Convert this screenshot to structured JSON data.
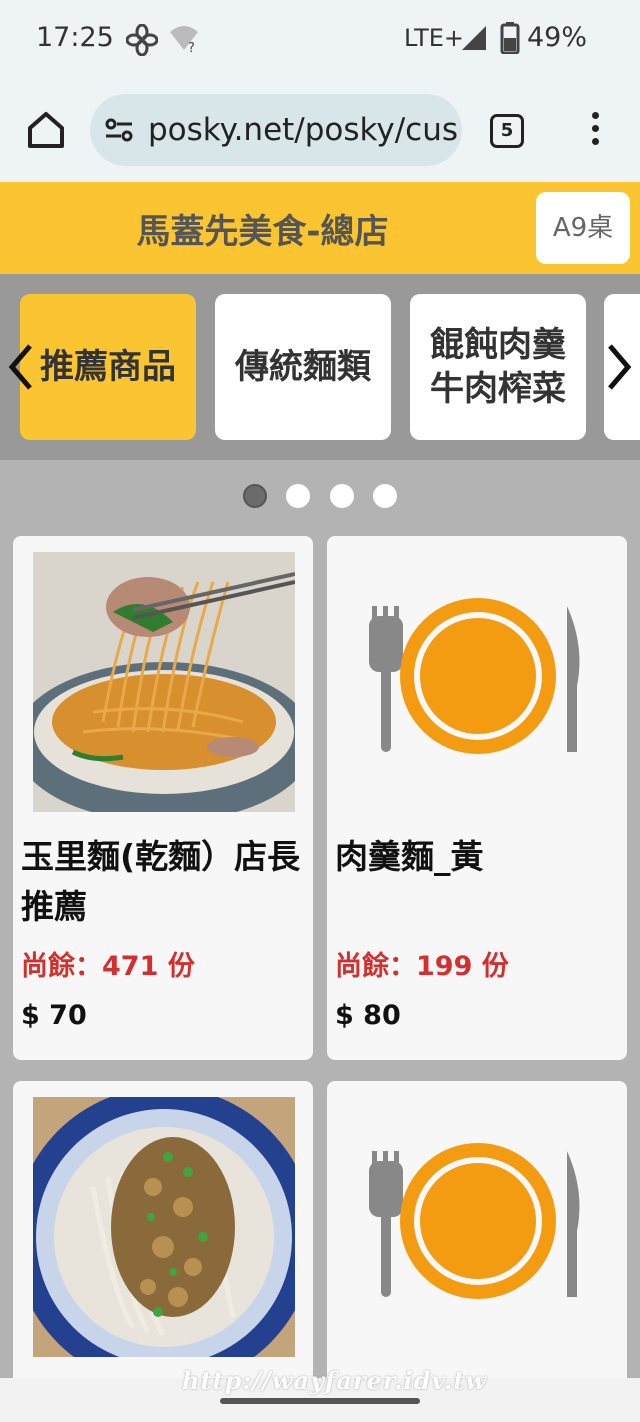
{
  "status_bar": {
    "time": "17:25",
    "network": "LTE+",
    "battery": "49%"
  },
  "browser": {
    "url": "posky.net/posky/cus",
    "tab_count": "5"
  },
  "header": {
    "store_name": "馬蓋先美食-總店",
    "table": "A9桌"
  },
  "categories": [
    {
      "label": "推薦商品",
      "active": true
    },
    {
      "label": "傳統麵類",
      "active": false
    },
    {
      "label": "餛飩肉羹\n牛肉榨菜",
      "active": false
    },
    {
      "label": "",
      "active": false
    }
  ],
  "pagination": {
    "pages": 4,
    "current": 1
  },
  "products": [
    {
      "name": "玉里麵(乾麵）店長推薦",
      "stock": "尚餘：471 份",
      "price": "$ 70",
      "image": "photo-noodles"
    },
    {
      "name": "肉羹麵_黃",
      "stock": "尚餘：199 份",
      "price": "$ 80",
      "image": "plate-placeholder"
    },
    {
      "name": "",
      "stock": "",
      "price": "",
      "image": "photo-noodles-pork"
    },
    {
      "name": "",
      "stock": "",
      "price": "",
      "image": "plate-placeholder"
    }
  ],
  "watermark": "http://wayfarer.idv.tw",
  "colors": {
    "accent": "#fbc531",
    "stock_red": "#d32f2f",
    "plate_orange": "#f39c12",
    "category_bg": "#999999"
  }
}
